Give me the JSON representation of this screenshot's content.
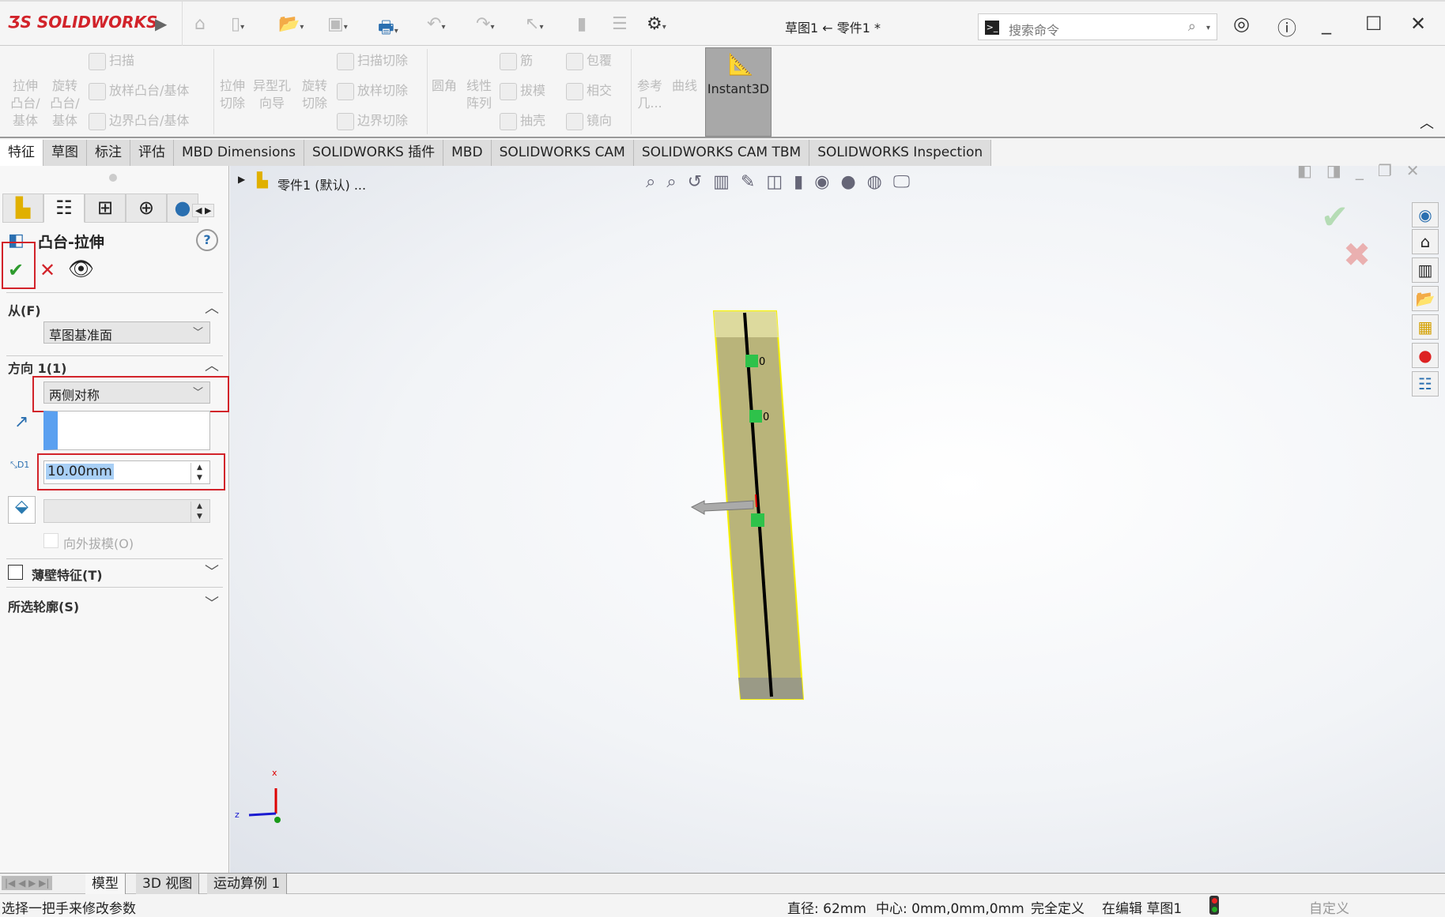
{
  "app": {
    "logo": "SOLIDWORKS",
    "doc_title": "草图1 ← 零件1 *"
  },
  "search": {
    "placeholder": "搜索命令"
  },
  "ribbon": {
    "extrude_boss": "拉伸凸台/基体",
    "revolve_boss": "旋转凸台/基体",
    "sweep": "扫描",
    "loft": "放样凸台/基体",
    "boundary": "边界凸台/基体",
    "extrude_cut": "拉伸切除",
    "hole_wizard": "异型孔向导",
    "revolve_cut": "旋转切除",
    "sweep_cut": "扫描切除",
    "loft_cut": "放样切除",
    "boundary_cut": "边界切除",
    "fillet": "圆角",
    "linear_pattern": "线性阵列",
    "rib": "筋",
    "draft": "拔模",
    "shell": "抽壳",
    "wrap": "包覆",
    "intersect": "相交",
    "mirror": "镜向",
    "reference": "参考几...",
    "curves": "曲线",
    "instant3d": "Instant3D"
  },
  "tabs": [
    "特征",
    "草图",
    "标注",
    "评估",
    "MBD Dimensions",
    "SOLIDWORKS 插件",
    "MBD",
    "SOLIDWORKS CAM",
    "SOLIDWORKS CAM TBM",
    "SOLIDWORKS Inspection"
  ],
  "tree": {
    "part": "零件1 (默认) ..."
  },
  "property_manager": {
    "title": "凸台-拉伸",
    "from": {
      "label": "从(F)",
      "value": "草图基准面"
    },
    "direction1": {
      "label": "方向 1(1)",
      "end_condition": "两侧对称",
      "depth": "10.00mm",
      "depth_icon_label": "D1",
      "draft_value": "",
      "draft_outward": "向外拔模(O)",
      "draft_outward_checked": false
    },
    "thin_feature": {
      "label": "薄壁特征(T)",
      "checked": false
    },
    "selected_contours": {
      "label": "所选轮廓(S)"
    }
  },
  "viewport": {
    "relation_labels": [
      "0",
      "0"
    ],
    "triad": {
      "x": "x",
      "z": "z"
    }
  },
  "bottom_tabs": [
    "模型",
    "3D 视图",
    "运动算例 1"
  ],
  "status": {
    "left": "选择一把手来修改参数",
    "diameter": "直径: 62mm",
    "center": "中心: 0mm,0mm,0mm",
    "defined": "完全定义",
    "editing": "在编辑 草图1",
    "custom": "自定义"
  },
  "colors": {
    "brand": "#d2232a",
    "highlight": "#d2232a",
    "model_edge": "#f5f000",
    "accept": "#2e9b2e"
  }
}
